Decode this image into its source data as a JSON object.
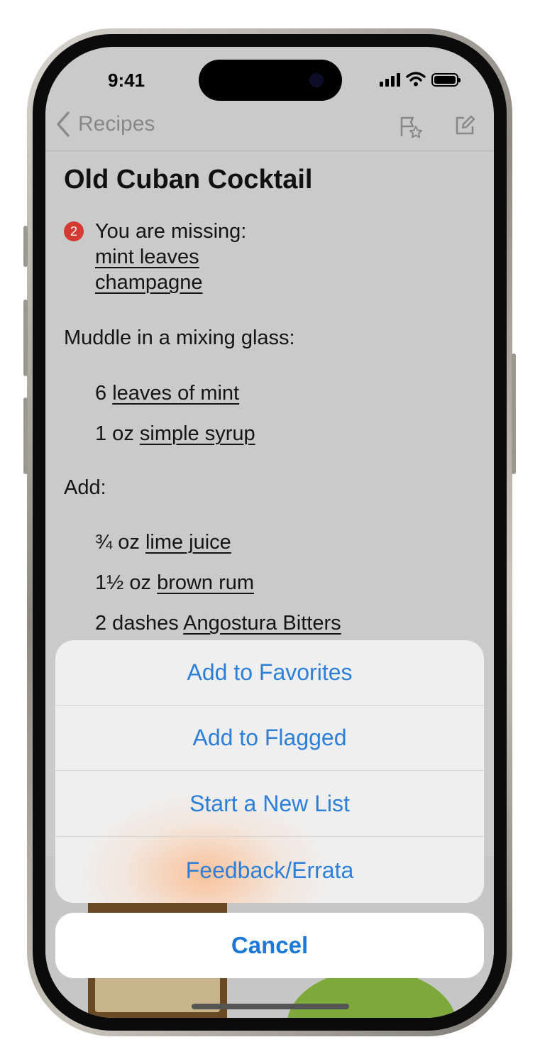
{
  "status_bar": {
    "time": "9:41"
  },
  "nav": {
    "back_label": "Recipes"
  },
  "recipe": {
    "title": "Old Cuban Cocktail",
    "missing_count": "2",
    "missing_label": "You are missing:",
    "missing_items": [
      "mint leaves",
      "champagne"
    ],
    "section1": "Muddle in a mixing glass:",
    "section1_items": [
      {
        "qty": "6",
        "ingredient": "leaves of mint"
      },
      {
        "qty": "1 oz",
        "ingredient": "simple syrup"
      }
    ],
    "section2": "Add:",
    "section2_items": [
      {
        "qty": "¾ oz",
        "ingredient": "lime juice"
      },
      {
        "qty": "1½ oz",
        "ingredient": "brown rum"
      },
      {
        "qty": "2 dashes",
        "ingredient": "Angostura Bitters"
      }
    ]
  },
  "action_sheet": {
    "items": [
      "Add to Favorites",
      "Add to Flagged",
      "Start a New List",
      "Feedback/Errata"
    ],
    "cancel": "Cancel"
  },
  "colors": {
    "accent": "#2b7fd8",
    "badge": "#d43a32"
  }
}
